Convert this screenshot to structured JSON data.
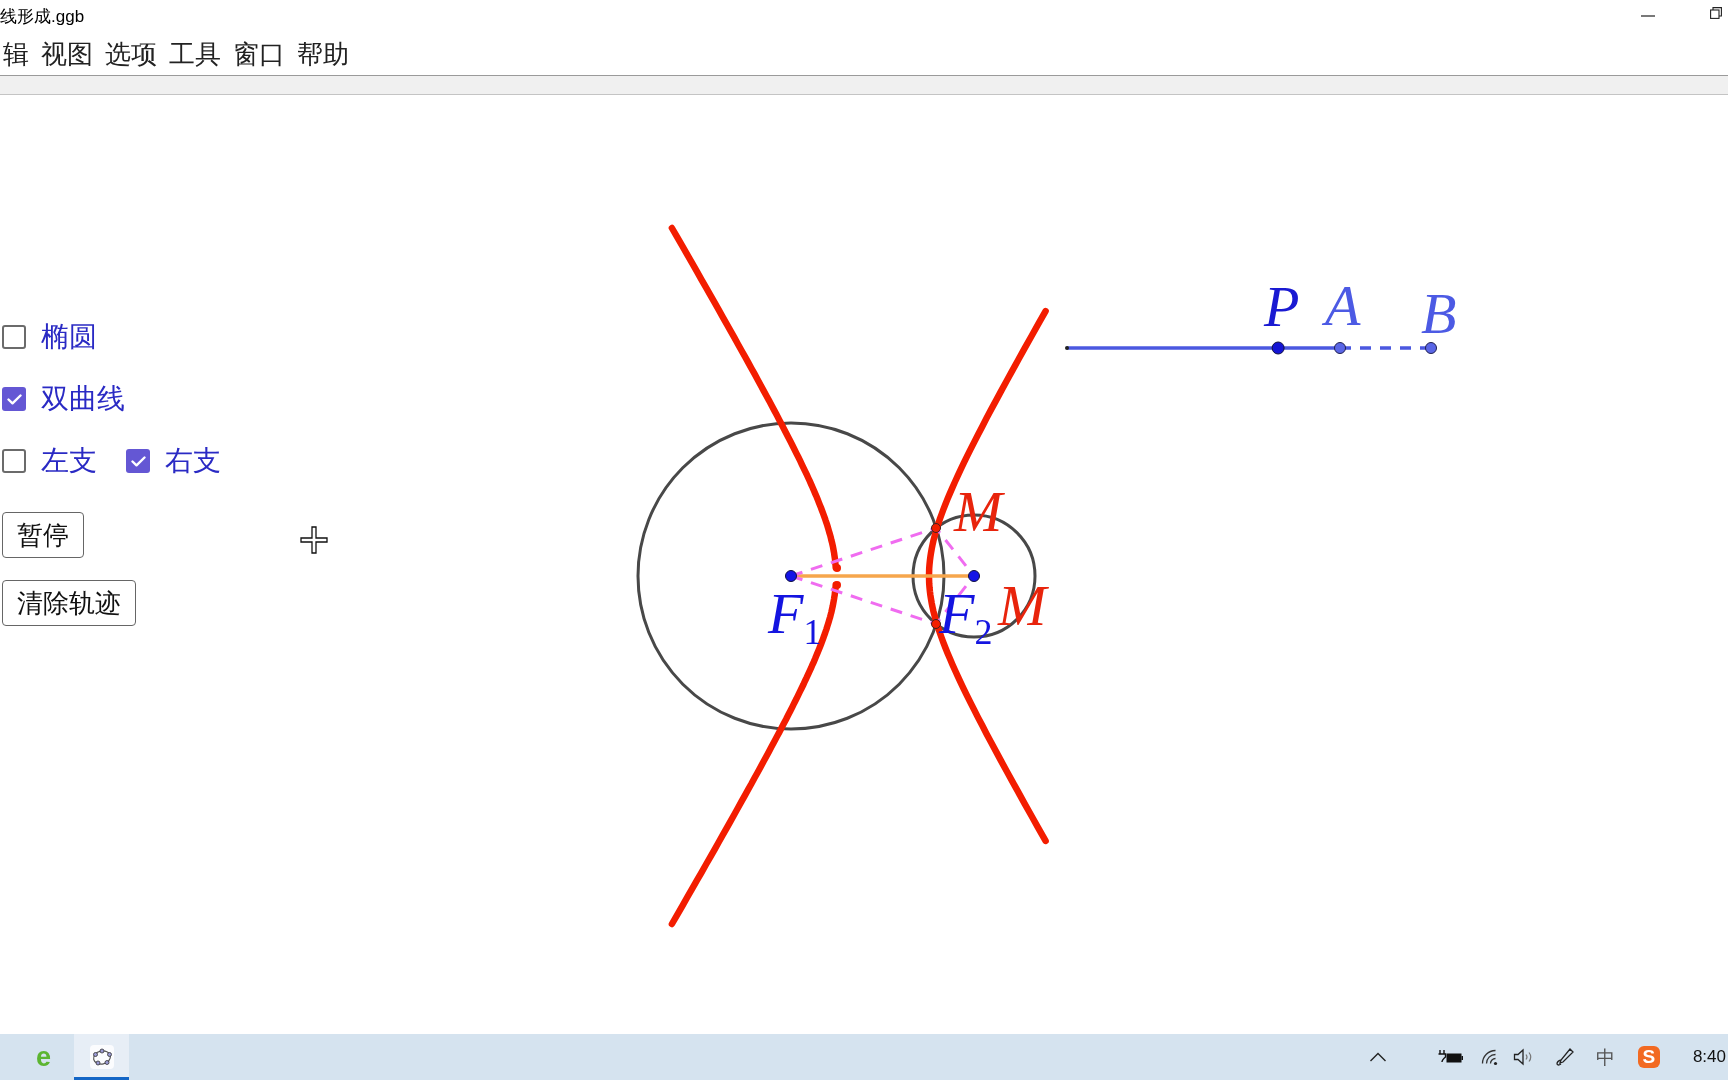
{
  "window": {
    "title": "线形成.ggb"
  },
  "menu": [
    "辑",
    "视图",
    "选项",
    "工具",
    "窗口",
    "帮助"
  ],
  "checkbox_rows": [
    {
      "items": [
        {
          "label": "椭圆",
          "checked": false
        }
      ]
    },
    {
      "items": [
        {
          "label": "双曲线",
          "checked": true
        }
      ]
    },
    {
      "items": [
        {
          "label": "左支",
          "checked": false
        },
        {
          "label": "右支",
          "checked": true
        }
      ]
    }
  ],
  "buttons": [
    "暂停",
    "清除轨迹"
  ],
  "diagram": {
    "slider": {
      "level": 0.58
    },
    "point_labels": [
      "P",
      "A",
      "B",
      "M",
      "F$_{1}$",
      "F$_{2}$",
      "M"
    ]
  },
  "taskbar": {
    "apps": [
      {
        "kind": "browser",
        "glyph": "e",
        "selected": false
      },
      {
        "kind": "geometry",
        "selected": true
      }
    ],
    "tray": {
      "input_mode": "中",
      "ime_logo": "S",
      "clock": "8:40"
    }
  }
}
